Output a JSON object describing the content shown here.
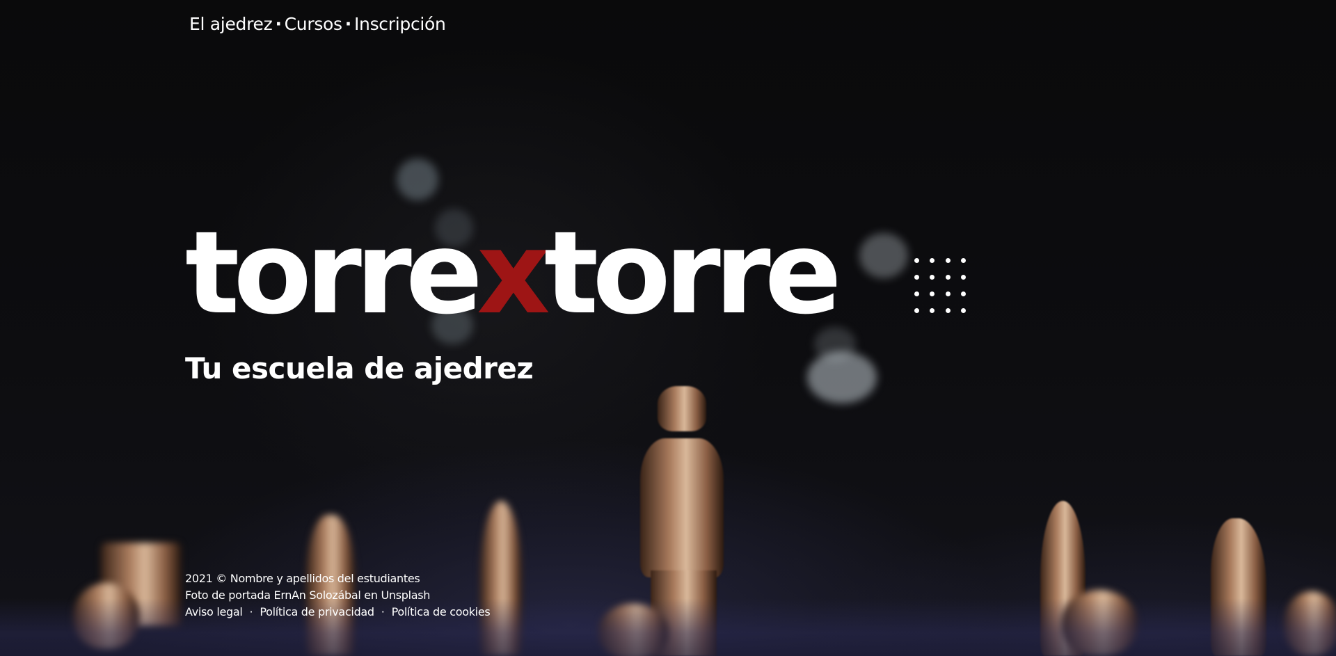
{
  "nav": {
    "items": [
      {
        "label": "El ajedrez"
      },
      {
        "label": "Cursos"
      },
      {
        "label": "Inscripción"
      }
    ],
    "separator": "·"
  },
  "hero": {
    "title_part1": "torre",
    "title_accent": "x",
    "title_part2": "torre",
    "subtitle": "Tu escuela de ajedrez",
    "accent_color": "#9e1515"
  },
  "footer": {
    "copyright": "2021 © Nombre y apellidos del estudiantes",
    "photo_credit": "Foto de portada ErnAn Solozábal en Unsplash",
    "links": [
      {
        "label": "Aviso legal"
      },
      {
        "label": "Política de privacidad"
      },
      {
        "label": "Política de cookies"
      }
    ],
    "separator": "·"
  }
}
